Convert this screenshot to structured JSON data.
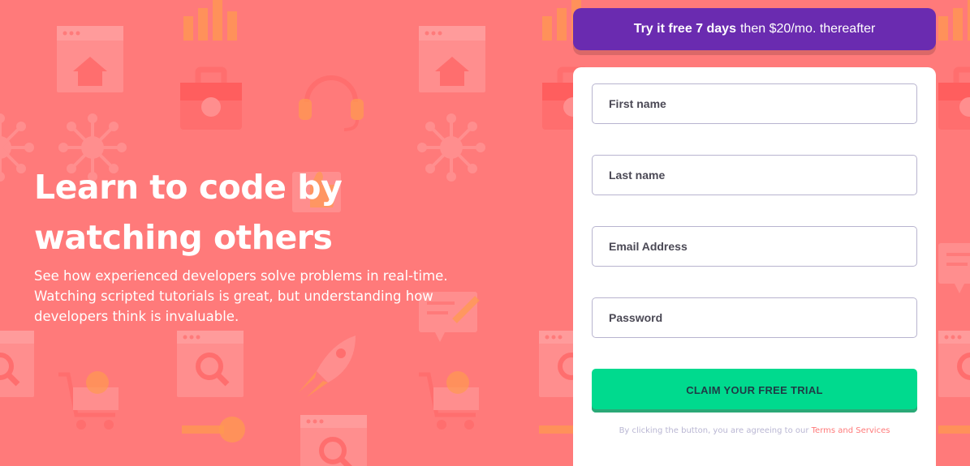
{
  "hero": {
    "title": "Learn to code by watching others",
    "description": "See how experienced developers solve problems in real-time. Watching scripted tutorials is great, but understanding how developers think is invaluable."
  },
  "promo": {
    "bold": "Try it free 7 days",
    "rest": "then $20/mo. thereafter"
  },
  "form": {
    "first_name_placeholder": "First name",
    "last_name_placeholder": "Last name",
    "email_placeholder": "Email Address",
    "password_placeholder": "Password",
    "submit_label": "CLAIM YOUR FREE TRIAL",
    "terms_prefix": "By clicking the button, you are agreeing to our",
    "terms_link": "Terms and Services"
  },
  "colors": {
    "background": "#ff7a7a",
    "promo": "#6a2bb0",
    "button": "#00da8e",
    "field_border": "#b8b4cf"
  },
  "icons": [
    "browser-window-icon",
    "house-icon",
    "toolbox-icon",
    "network-icon",
    "headset-icon",
    "thumbs-up-icon",
    "magnifier-icon",
    "rocket-icon",
    "gear-icon",
    "shopping-cart-icon",
    "key-icon",
    "chart-icon",
    "chat-pencil-icon"
  ]
}
